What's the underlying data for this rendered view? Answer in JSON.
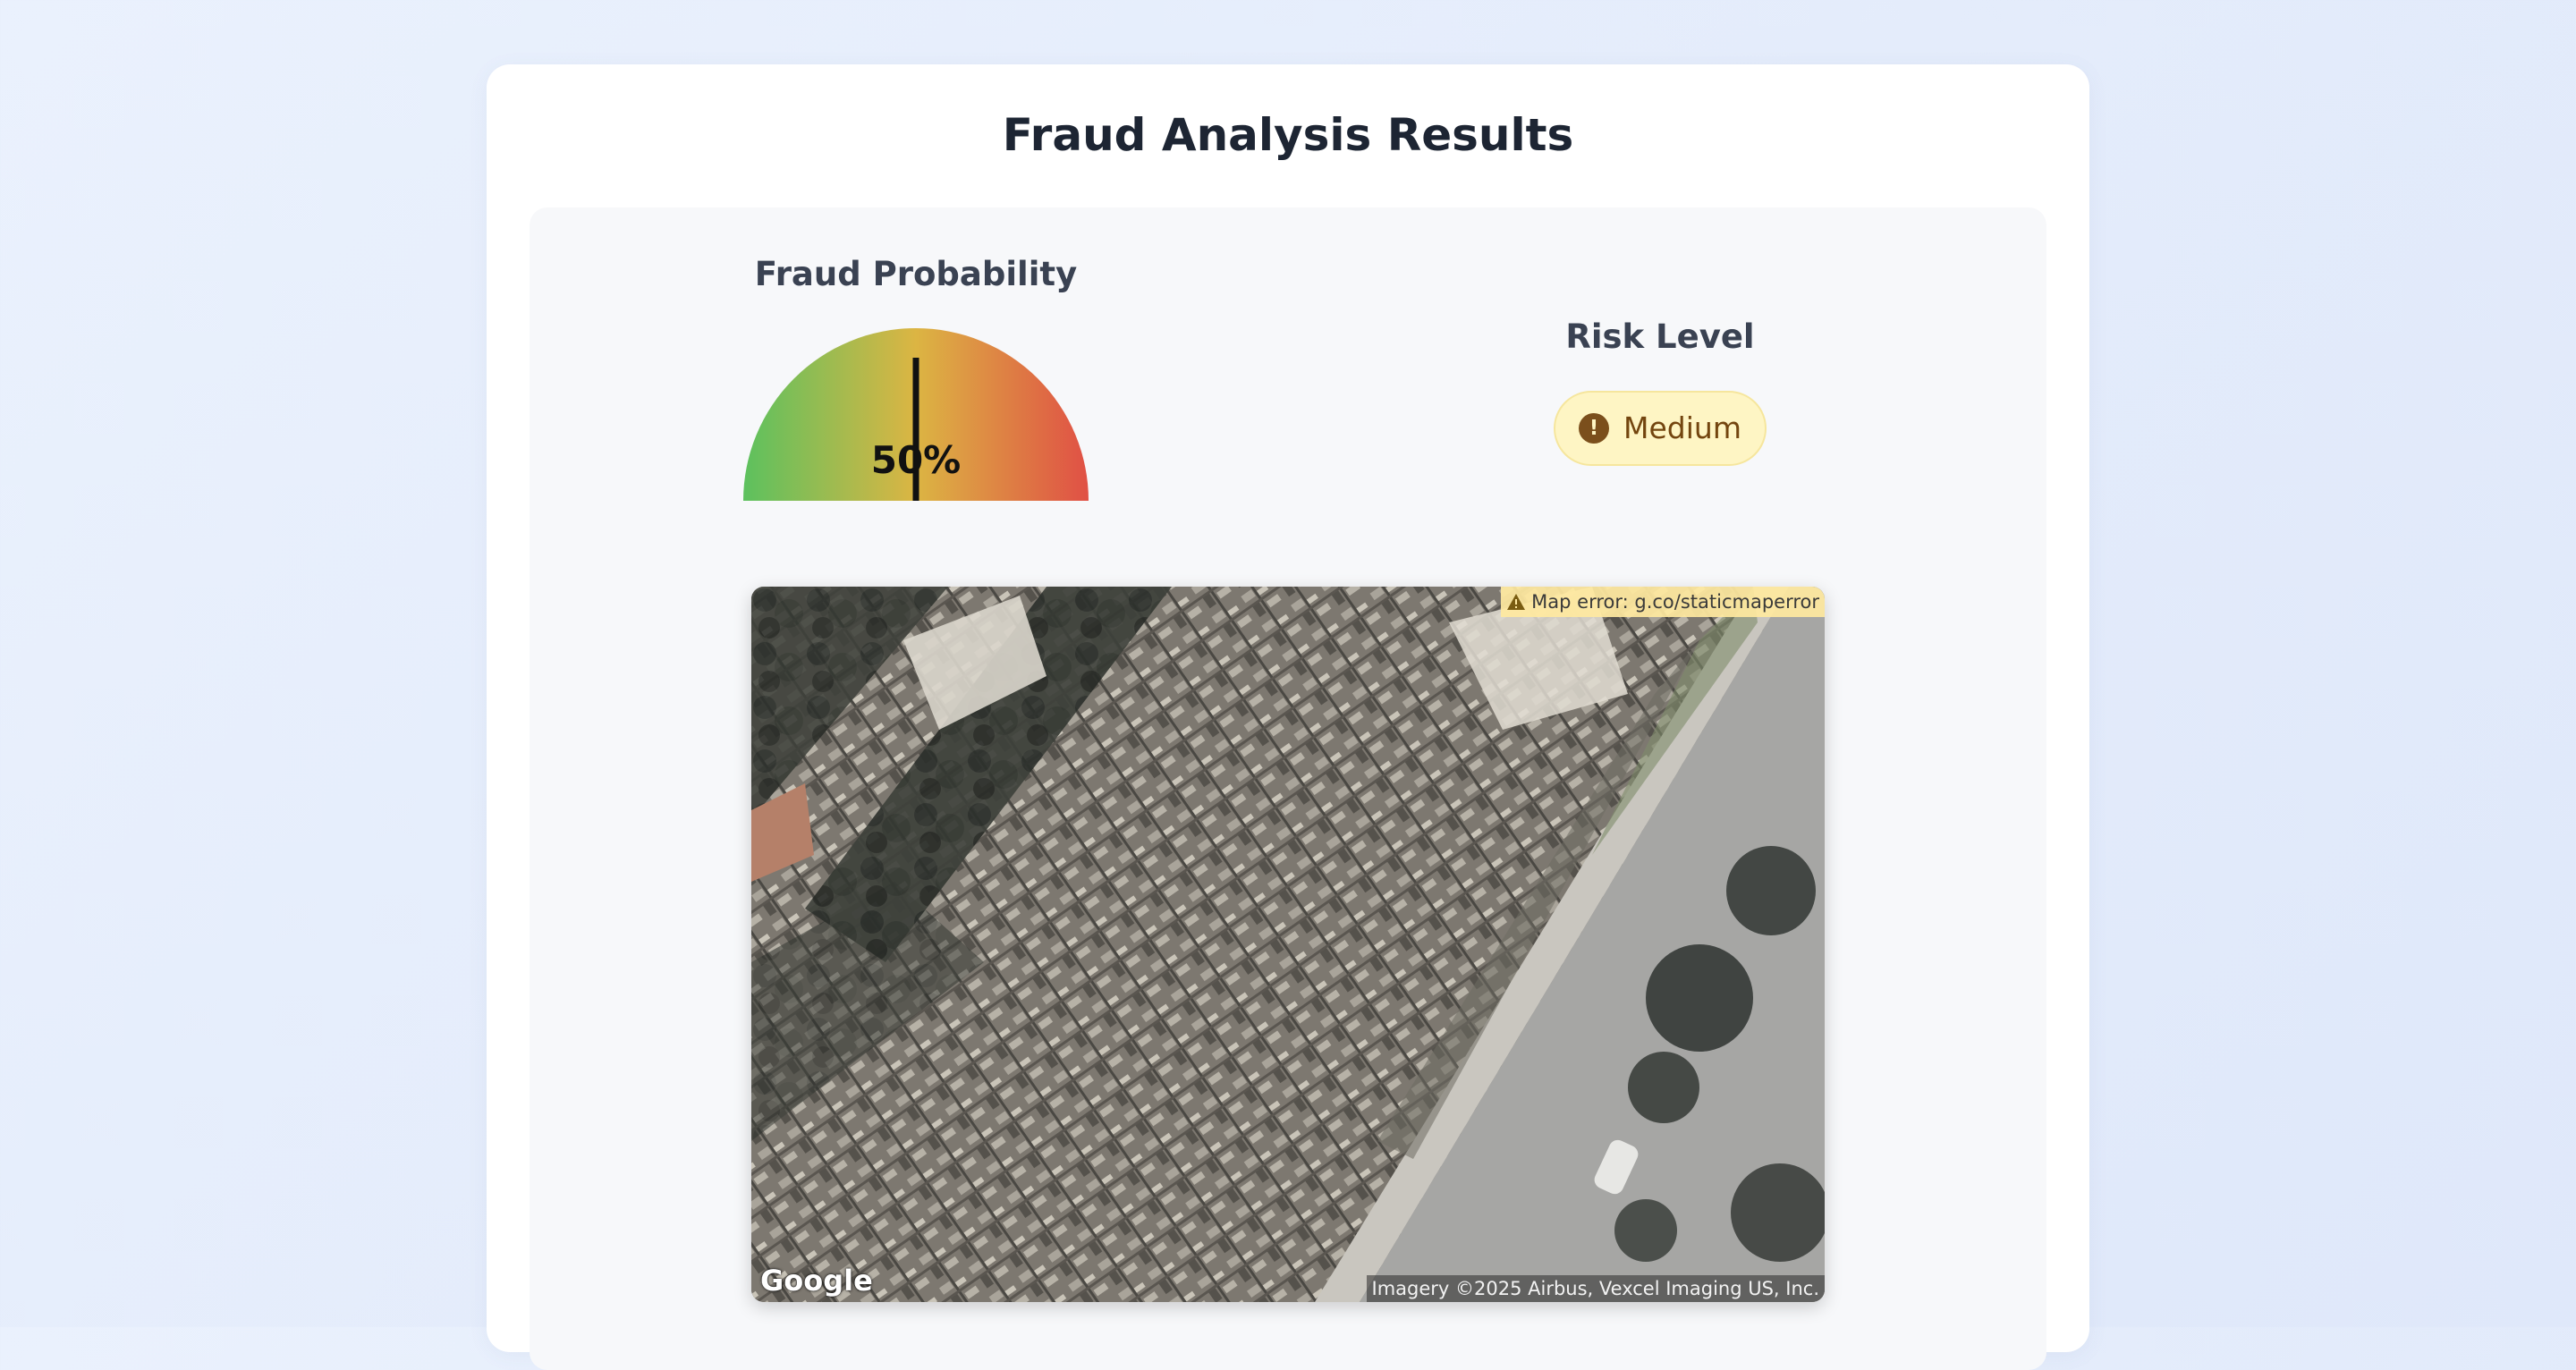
{
  "page": {
    "title": "Fraud Analysis Results"
  },
  "fraud_probability": {
    "label": "Fraud Probability",
    "value_text": "50%",
    "value": 0.5,
    "colors": {
      "low": "#5cc15e",
      "mid": "#dcb543",
      "high": "#e05045"
    }
  },
  "risk": {
    "label": "Risk Level",
    "level": "Medium",
    "icon": "alert-circle-icon",
    "icon_glyph": "!",
    "badge_bg": "#fef5c4",
    "badge_text_color": "#73450f"
  },
  "map": {
    "error_text": "Map error: g.co/staticmaperror",
    "attribution": "Imagery ©2025 Airbus, Vexcel Imaging US, Inc.",
    "logo_text": "Google"
  }
}
